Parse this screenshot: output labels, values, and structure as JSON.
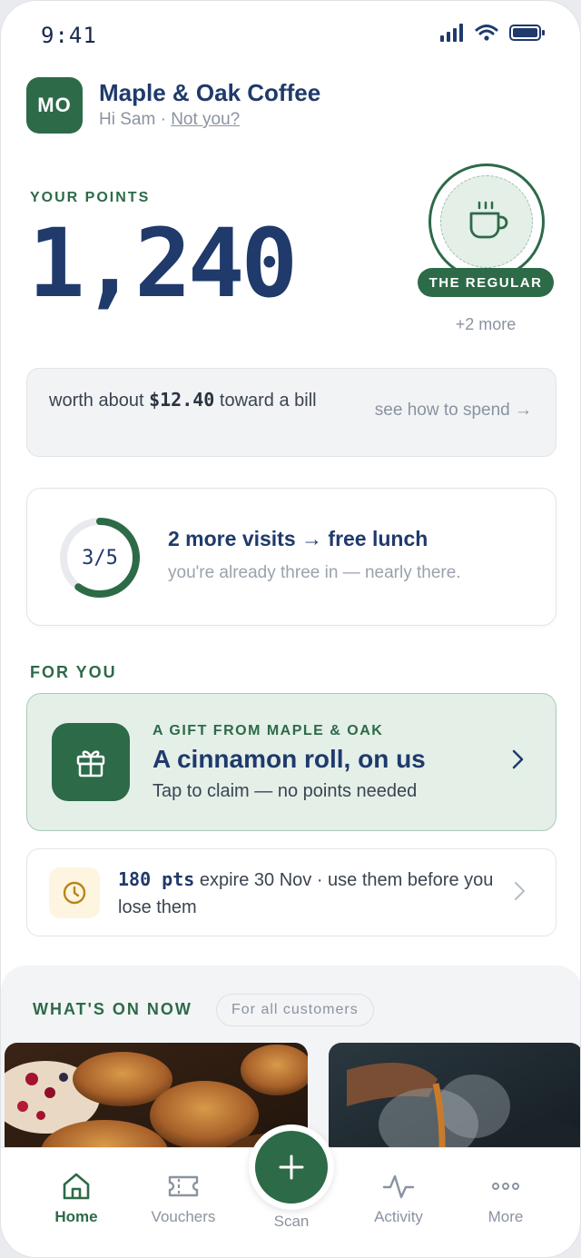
{
  "status_bar": {
    "time": "9:41"
  },
  "header": {
    "avatar_initials": "MO",
    "shop_name": "Maple & Oak Coffee",
    "greeting": "Hi Sam ·",
    "not_you": "Not you?"
  },
  "points": {
    "label": "YOUR POINTS",
    "value": "1,240",
    "tier_badge": "THE REGULAR",
    "tier_icon": "coffee-cup-icon",
    "more_badges": "+2 more"
  },
  "worth": {
    "prefix": "worth about",
    "amount": "$12.40",
    "suffix": "toward a bill",
    "link": "see how to spend →"
  },
  "visits": {
    "progress_label": "3/5",
    "progress_fraction": 0.6,
    "title": "2 more visits → free lunch",
    "subtitle": "you're already three in — nearly there."
  },
  "for_you": {
    "label": "FOR YOU",
    "gift": {
      "eyebrow": "A GIFT FROM MAPLE & OAK",
      "title": "A cinnamon roll, on us",
      "subtitle": "Tap to claim — no points needed",
      "icon": "gift-icon"
    },
    "expiry": {
      "points": "180 pts",
      "text": "expire 30 Nov · use them before you lose them",
      "icon": "clock-icon"
    }
  },
  "whats_on": {
    "label": "WHAT'S ON NOW",
    "chip": "For all customers"
  },
  "nav": {
    "home": "Home",
    "vouchers": "Vouchers",
    "scan": "Scan",
    "activity": "Activity",
    "more": "More"
  },
  "colors": {
    "brand_green": "#2d6a48",
    "navy": "#1f3a6b",
    "muted": "#8a93a0",
    "mint": "#e4efe8"
  }
}
